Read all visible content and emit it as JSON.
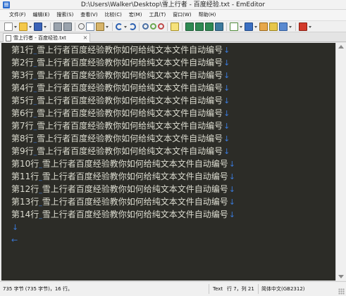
{
  "window": {
    "title": "D:\\Users\\Walker\\Desktop\\雪上行者 - 百度经验.txt - EmEditor"
  },
  "menu": [
    "文件(F)",
    "编辑(E)",
    "搜索(S)",
    "查看(V)",
    "比较(C)",
    "宏(M)",
    "工具(T)",
    "窗口(W)",
    "帮助(H)"
  ],
  "toolbar_icons": [
    "new-file-icon",
    "open-file-icon",
    "save-icon",
    "print-icon",
    "cut-icon",
    "copy-icon",
    "paste-icon",
    "undo-icon",
    "redo-icon",
    "find-icon",
    "find-next-icon",
    "replace-icon",
    "marker-icon",
    "window-layout-icon",
    "macro-icon",
    "tools-icon",
    "stop-icon"
  ],
  "tab": {
    "label": "雪上行者 - 百度经验.txt",
    "close": "×"
  },
  "editor": {
    "lines": [
      "第1行_雪上行者百度经验教你如何给纯文本文件自动编号",
      "第2行_雪上行者百度经验教你如何给纯文本文件自动编号",
      "第3行_雪上行者百度经验教你如何给纯文本文件自动编号",
      "第4行_雪上行者百度经验教你如何给纯文本文件自动编号",
      "第5行_雪上行者百度经验教你如何给纯文本文件自动编号",
      "第6行_雪上行者百度经验教你如何给纯文本文件自动编号",
      "第7行_雪上行者百度经验教你如何给纯文本文件自动编号",
      "第8行_雪上行者百度经验教你如何给纯文本文件自动编号",
      "第9行_雪上行者百度经验教你如何给纯文本文件自动编号",
      "第10行_雪上行者百度经验教你如何给纯文本文件自动编号",
      "第11行_雪上行者百度经验教你如何给纯文本文件自动编号",
      "第12行_雪上行者百度经验教你如何给纯文本文件自动编号",
      "第13行_雪上行者百度经验教你如何给纯文本文件自动编号",
      "第14行_雪上行者百度经验教你如何给纯文本文件自动编号"
    ],
    "eol_mark": "↓",
    "eof_mark": "←",
    "background": "#2c2c27",
    "text_color": "#dcdcd0",
    "mark_color": "#3a78d6"
  },
  "status": {
    "bytes": "735 字节 (735 字节)，16 行。",
    "mode": "Text",
    "position": "行 7，列 21",
    "encoding": "简体中文(GB2312)"
  }
}
